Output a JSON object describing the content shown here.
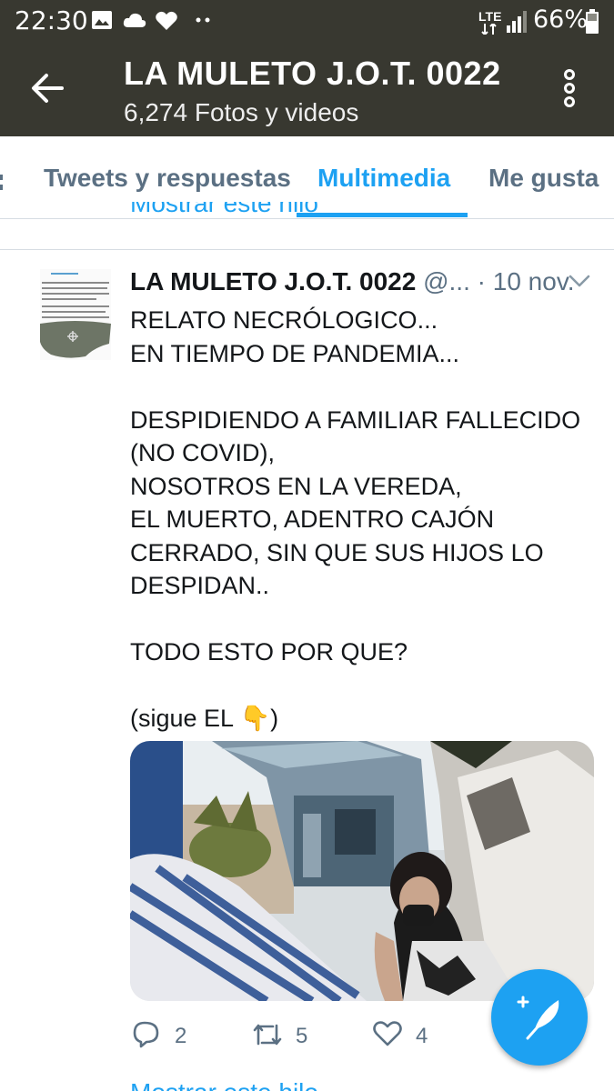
{
  "status_bar": {
    "time": "22:30",
    "network": "LTE",
    "battery": "66%",
    "icons": [
      "image-icon",
      "cloud-icon",
      "heart-icon",
      "dots-icon",
      "signal-icon",
      "battery-icon"
    ]
  },
  "header": {
    "title": "LA MULETO J.O.T. 0022",
    "subtitle": "6,274 Fotos y videos"
  },
  "tabs": [
    {
      "label": "Tweets y respuestas",
      "active": false
    },
    {
      "label": "Multimedia",
      "active": true
    },
    {
      "label": "Me gusta",
      "active": false
    }
  ],
  "previous_tweet": {
    "show_thread": "Mostrar este hilo"
  },
  "tweet": {
    "author_name": "LA MULETO J.O.T. 0022",
    "handle": "@...",
    "date": "· 10 nov.",
    "lines": [
      "RELATO NECRÓLOGICO...",
      "EN TIEMPO DE PANDEMIA...",
      "",
      "DESPIDIENDO A FAMILIAR FALLECIDO",
      "(NO COVID),",
      "NOSOTROS EN LA VEREDA,",
      "EL MUERTO, ADENTRO CAJÓN",
      "CERRADO, SIN QUE SUS HIJOS LO",
      "DESPIDAN..",
      "",
      "TODO ESTO POR QUE?",
      "",
      "(sigue EL 👇)"
    ],
    "replies": "2",
    "retweets": "5",
    "likes": "4",
    "show_thread": "Mostrar este hilo"
  },
  "colors": {
    "app_bar": "#383830",
    "accent": "#1da1f2",
    "muted": "#5b7083"
  }
}
